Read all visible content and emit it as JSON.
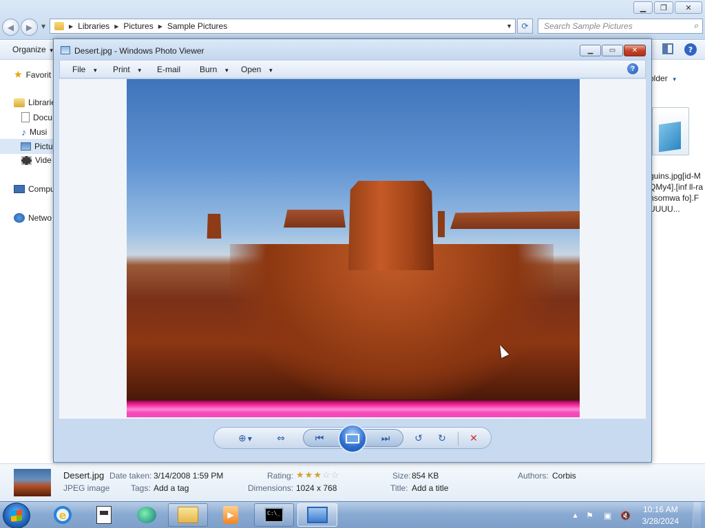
{
  "explorer": {
    "address": {
      "crumbs": [
        "Libraries",
        "Pictures",
        "Sample Pictures"
      ]
    },
    "search_placeholder": "Search Sample Pictures",
    "toolbar": {
      "organize_label": "Organize"
    },
    "new_folder_label": "older",
    "nav": {
      "favorites": "Favorit",
      "libraries": "Librarie",
      "documents": "Docu",
      "music": "Musi",
      "pictures": "Pictu",
      "videos": "Vide",
      "computer": "Compu",
      "network": "Netwo"
    },
    "bg_file_name": "guins.jpg[id-MQMy4].[inf ll-ransomwa fo].FUUUU...",
    "details": {
      "filename": "Desert.jpg",
      "filetype": "JPEG image",
      "date_taken_label": "Date taken:",
      "date_taken_value": "3/14/2008 1:59 PM",
      "tags_label": "Tags:",
      "tags_value": "Add a tag",
      "rating_label": "Rating:",
      "rating": 3,
      "rating_max": 5,
      "dimensions_label": "Dimensions:",
      "dimensions_value": "1024 x 768",
      "size_label": "Size:",
      "size_value": "854 KB",
      "title_label": "Title:",
      "title_value": "Add a title",
      "authors_label": "Authors:",
      "authors_value": "Corbis"
    }
  },
  "photo_viewer": {
    "title": "Desert.jpg - Windows Photo Viewer",
    "menu": {
      "file": "File",
      "print": "Print",
      "email": "E-mail",
      "burn": "Burn",
      "open": "Open"
    },
    "controls": {
      "zoom": "zoom-icon",
      "fit": "actual-size-icon",
      "previous": "previous-icon",
      "slideshow": "slideshow-icon",
      "next": "next-icon",
      "rotate_ccw": "rotate-left-icon",
      "rotate_cw": "rotate-right-icon",
      "delete": "delete-icon"
    }
  },
  "taskbar": {
    "clock_time": "10:16 AM",
    "clock_date": "3/28/2024",
    "cmd_text": "C:\\_"
  },
  "colors": {
    "glitch_band": "#ff33aa",
    "taskbar": "#8aabd3",
    "close_button": "#c4432a"
  }
}
